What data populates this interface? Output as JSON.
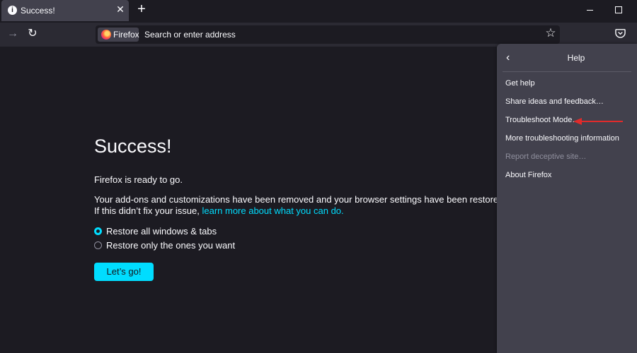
{
  "tab": {
    "title": "Success!",
    "info_icon": "i",
    "close_icon": "✕"
  },
  "new_tab_icon": "+",
  "urlbar": {
    "identity_label": "Firefox",
    "placeholder": "Search or enter address"
  },
  "page": {
    "title": "Success!",
    "ready_text": "Firefox is ready to go.",
    "info_line_1": "Your add-ons and customizations have been removed and your browser settings have been restored to their defaults.",
    "info_line_2_prefix": "If this didn’t fix your issue,",
    "learn_more_link": "learn more about what you can do.",
    "radio_options": [
      {
        "label": "Restore all windows & tabs",
        "checked": true
      },
      {
        "label": "Restore only the ones you want",
        "checked": false
      }
    ],
    "button_label": "Let’s go!"
  },
  "help_menu": {
    "title": "Help",
    "items": [
      {
        "label": "Get help",
        "enabled": true
      },
      {
        "label": "Share ideas and feedback…",
        "enabled": true
      },
      {
        "label": "Troubleshoot Mode…",
        "enabled": true
      },
      {
        "label": "More troubleshooting information",
        "enabled": true
      },
      {
        "label": "Report deceptive site…",
        "enabled": false
      },
      {
        "label": "About Firefox",
        "enabled": true
      }
    ]
  },
  "colors": {
    "accent": "#00ddff",
    "annotation_arrow": "#e02b2b",
    "panel": "#42414d",
    "background": "#1c1b22"
  }
}
